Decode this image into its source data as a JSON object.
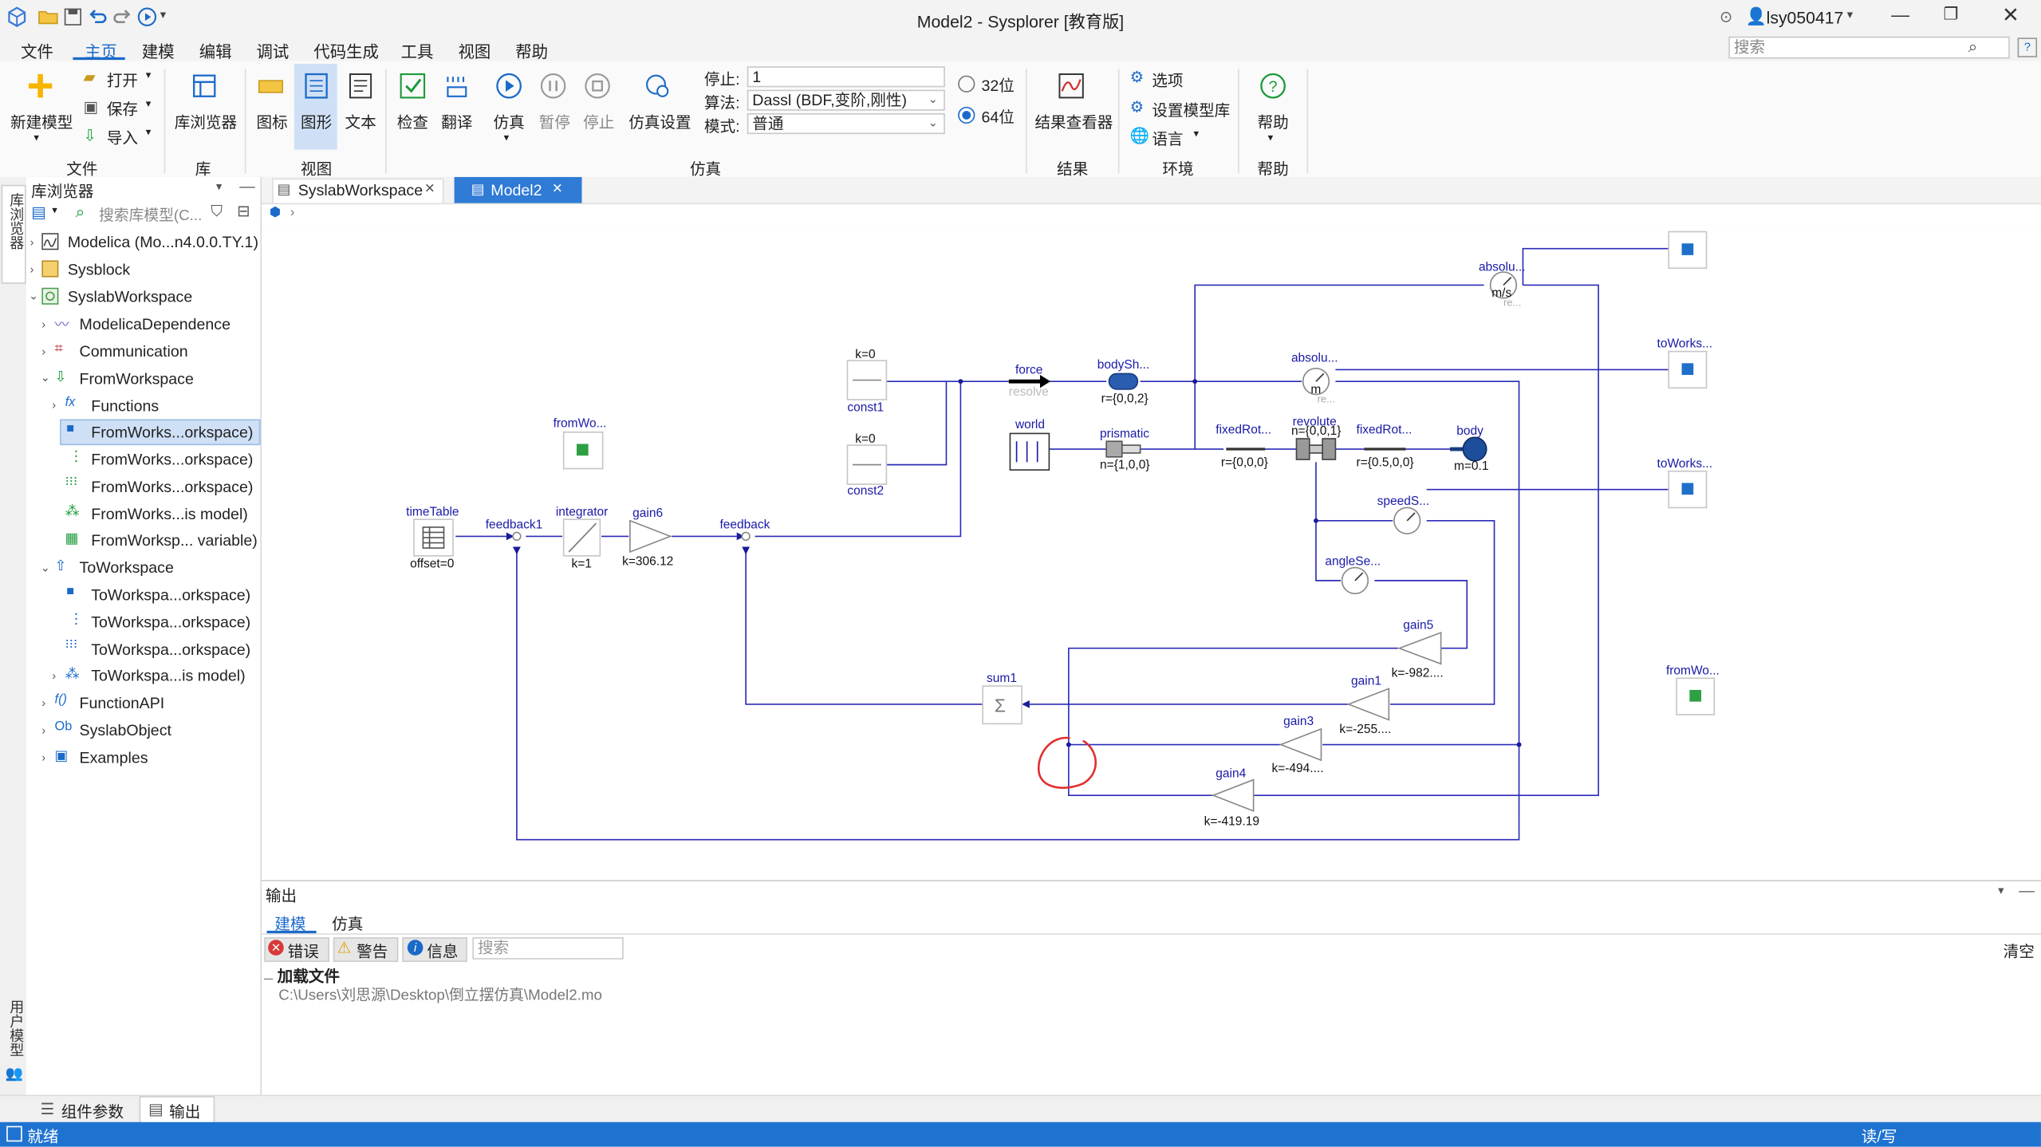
{
  "window": {
    "title": "Model2 - Sysplorer [教育版]",
    "user": "lsy050417"
  },
  "menu": [
    "文件",
    "主页",
    "建模",
    "编辑",
    "调试",
    "代码生成",
    "工具",
    "视图",
    "帮助"
  ],
  "search_placeholder": "搜索",
  "ribbon": {
    "new_model": "新建模型",
    "open": "打开",
    "save": "保存",
    "import": "导入",
    "library_browser": "库浏览器",
    "icon": "图标",
    "diagram": "图形",
    "text": "文本",
    "check": "检查",
    "translate": "翻译",
    "simulate": "仿真",
    "pause": "暂停",
    "stop": "停止",
    "sim_settings": "仿真设置",
    "stop_label": "停止:",
    "stop_value": "1",
    "algo_label": "算法:",
    "algo_value": "Dassl (BDF,变阶,刚性)",
    "mode_label": "模式:",
    "mode_value": "普通",
    "bit32": "32位",
    "bit64": "64位",
    "result_viewer": "结果查看器",
    "options": "选项",
    "set_model_lib": "设置模型库",
    "language": "语言",
    "help": "帮助",
    "groups": {
      "file": "文件",
      "lib": "库",
      "view": "视图",
      "sim": "仿真",
      "result": "结果",
      "env": "环境",
      "help": "帮助"
    }
  },
  "vstrip": {
    "lib": "库浏览器",
    "user_model": "用户模型"
  },
  "library": {
    "title": "库浏览器",
    "search_placeholder": "搜索库模型(C...",
    "items": [
      "Modelica (Mo...n4.0.0.TY.1)",
      "Sysblock",
      "SyslabWorkspace",
      "ModelicaDependence",
      "Communication",
      "FromWorkspace",
      "Functions",
      "FromWorks...orkspace)",
      "FromWorks...orkspace)",
      "FromWorks...orkspace)",
      "FromWorks...is model)",
      "FromWorksp... variable)",
      "ToWorkspace",
      "ToWorkspa...orkspace)",
      "ToWorkspa...orkspace)",
      "ToWorkspa...orkspace)",
      "ToWorkspa...is model)",
      "FunctionAPI",
      "SyslabObject",
      "Examples"
    ]
  },
  "tabs": [
    "SyslabWorkspace",
    "Model2"
  ],
  "diagram": {
    "absolu1": "absolu...",
    "ms": "m/s",
    "re": "re...",
    "toWorks1": "toWorks...",
    "toWorks2": "toWorks...",
    "absolu2": "absolu...",
    "m": "m",
    "re2": "re...",
    "k0a": "k=0",
    "const1": "const1",
    "k0b": "k=0",
    "const2": "const2",
    "force": "force",
    "resolve": "resolve",
    "bodySh": "bodySh...",
    "r002": "r={0,0,2}",
    "world": "world",
    "prismatic": "prismatic",
    "n100": "n={1,0,0}",
    "fixedRot1": "fixedRot...",
    "r000": "r={0,0,0}",
    "revolute": "revolute",
    "n001": "n={0,0,1}",
    "fixedRot2": "fixedRot...",
    "r0500": "r={0.5,0,0}",
    "body": "body",
    "m01": "m=0.1",
    "fromWo1": "fromWo...",
    "fromWo2": "fromWo...",
    "timeTable": "timeTable",
    "offset0": "offset=0",
    "feedback1": "feedback1",
    "integrator": "integrator",
    "k1": "k=1",
    "gain6": "gain6",
    "k306": "k=306.12",
    "feedback": "feedback",
    "speedS": "speedS...",
    "angleSe": "angleSe...",
    "gain5": "gain5",
    "k982": "k=-982....",
    "sum1": "sum1",
    "gain1": "gain1",
    "k255": "k=-255....",
    "gain3": "gain3",
    "k494": "k=-494....",
    "gain4": "gain4",
    "k419": "k=-419.19"
  },
  "output": {
    "title": "输出",
    "tab_model": "建模",
    "tab_sim": "仿真",
    "error": "错误",
    "warning": "警告",
    "info": "信息",
    "search_placeholder": "搜索",
    "clear": "清空",
    "log_title": "加载文件",
    "log_path": "C:\\Users\\刘思源\\Desktop\\倒立摆仿真\\Model2.mo"
  },
  "bottom_tabs": {
    "params": "组件参数",
    "output": "输出"
  },
  "status": {
    "ready": "就绪",
    "rw": "读/写"
  }
}
